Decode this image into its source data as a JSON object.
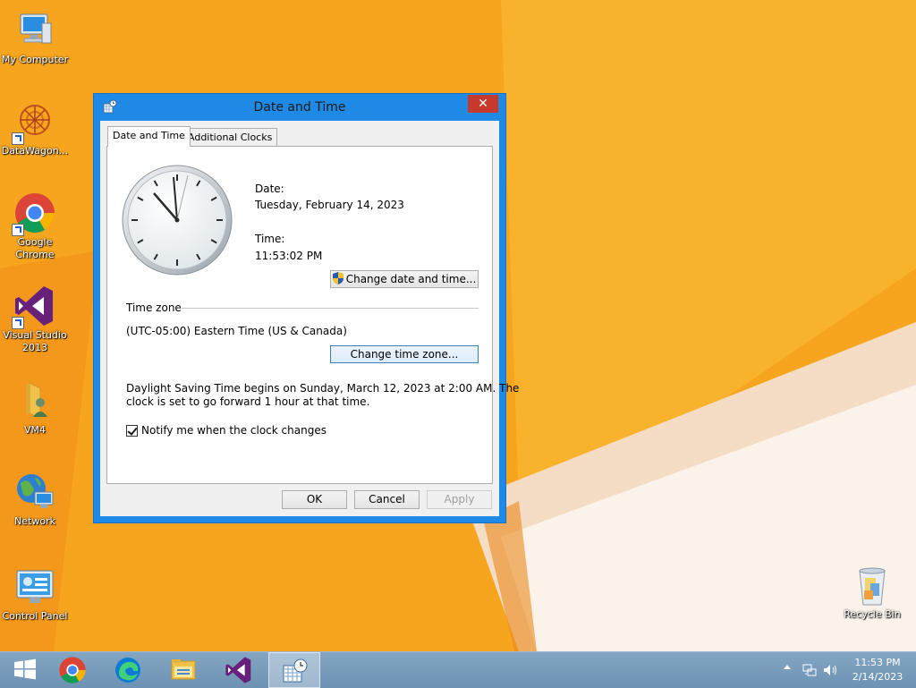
{
  "desktop": {
    "icons": [
      {
        "label": "My Computer",
        "icon": "computer-icon"
      },
      {
        "label": "DataWagon...",
        "icon": "datawagon-icon"
      },
      {
        "label": "Google Chrome",
        "icon": "chrome-icon"
      },
      {
        "label": "Visual Studio 2013",
        "icon": "visual-studio-icon"
      },
      {
        "label": "VM4",
        "icon": "user-folder-icon"
      },
      {
        "label": "Network",
        "icon": "network-icon"
      },
      {
        "label": "Control Panel",
        "icon": "control-panel-icon"
      },
      {
        "label": "Recycle Bin",
        "icon": "recycle-bin-icon"
      }
    ]
  },
  "dialog": {
    "title": "Date and Time",
    "close_label": "✕",
    "tabs": [
      {
        "label": "Date and Time",
        "active": true
      },
      {
        "label": "Additional Clocks",
        "active": false
      }
    ],
    "date_label": "Date:",
    "date_value": "Tuesday, February 14, 2023",
    "time_label": "Time:",
    "time_value": "11:53:02 PM",
    "change_datetime_button": "Change date and time...",
    "timezone_heading": "Time zone",
    "timezone_value": "(UTC-05:00) Eastern Time (US & Canada)",
    "change_timezone_button": "Change time zone...",
    "dst_line1": "Daylight Saving Time begins on Sunday, March 12, 2023 at 2:00 AM. The",
    "dst_line2": "clock is set to go forward 1 hour at that time.",
    "notify_label": "Notify me when the clock changes",
    "notify_checked": true,
    "ok_button": "OK",
    "cancel_button": "Cancel",
    "apply_button": "Apply"
  },
  "taskbar": {
    "items": [
      "start-icon",
      "chrome-icon",
      "edge-icon",
      "file-explorer-icon",
      "visual-studio-icon",
      "date-time-icon"
    ],
    "clock_time": "11:53 PM",
    "clock_date": "2/14/2023"
  }
}
